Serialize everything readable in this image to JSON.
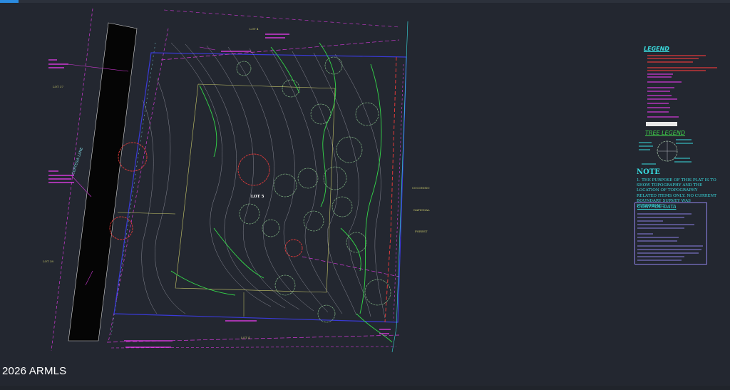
{
  "watermark": "2026 ARMLS",
  "plan": {
    "lot_label": "LOT 5",
    "street_name": "CORTESIA LANE",
    "adjacent_lots": [
      "LOT 4",
      "LOT 4",
      "LOT 37",
      "LOT 38"
    ],
    "right_labels": [
      "COCONINO",
      "NATIONAL",
      "FOREST"
    ]
  },
  "legend": {
    "title": "LEGEND",
    "tree_legend_title": "TREE LEGEND"
  },
  "note": {
    "title": "NOTE",
    "text": "1. THE PURPOSE OF THIS PLAT IS TO SHOW TOPOGRAPHY AND THE LOCATION OF TOPOGRAPHY RELATED ITEMS ONLY. NO CURRENT BOUNDARY SURVEY WAS PERFORMED."
  },
  "control": {
    "title": "CONTROL DATA"
  },
  "colors": {
    "background": "#232730",
    "boundary": "#3a3ad8",
    "magenta": "#d23ad8",
    "green": "#34d84a",
    "cyan": "#38dce0",
    "red": "#e03a3a",
    "contour": "#b9b9c4"
  }
}
